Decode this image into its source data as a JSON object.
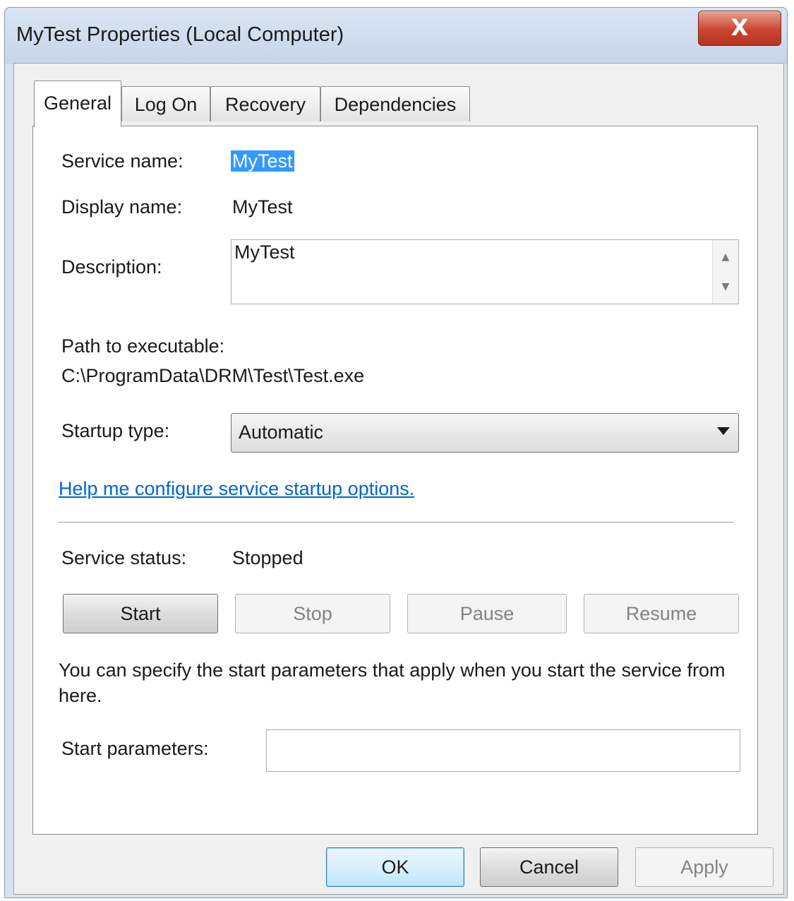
{
  "window": {
    "title": "MyTest Properties (Local Computer)",
    "close_glyph": "X"
  },
  "tabs": [
    {
      "label": "General",
      "active": true
    },
    {
      "label": "Log On",
      "active": false
    },
    {
      "label": "Recovery",
      "active": false
    },
    {
      "label": "Dependencies",
      "active": false
    }
  ],
  "general": {
    "service_name_label": "Service name:",
    "service_name_value": "MyTest",
    "display_name_label": "Display name:",
    "display_name_value": "MyTest",
    "description_label": "Description:",
    "description_value": "MyTest",
    "path_label": "Path to executable:",
    "path_value": "C:\\ProgramData\\DRM\\Test\\Test.exe",
    "startup_type_label": "Startup type:",
    "startup_type_value": "Automatic",
    "help_link": "Help me configure service startup options.",
    "service_status_label": "Service status:",
    "service_status_value": "Stopped",
    "buttons": {
      "start": "Start",
      "stop": "Stop",
      "pause": "Pause",
      "resume": "Resume"
    },
    "help_text": "You can specify the start parameters that apply when you start the service from here.",
    "start_params_label": "Start parameters:",
    "start_params_value": ""
  },
  "footer": {
    "ok": "OK",
    "cancel": "Cancel",
    "apply": "Apply"
  },
  "colors": {
    "selection": "#3399ff",
    "link": "#0066cc",
    "close_button": "#c9452f"
  }
}
